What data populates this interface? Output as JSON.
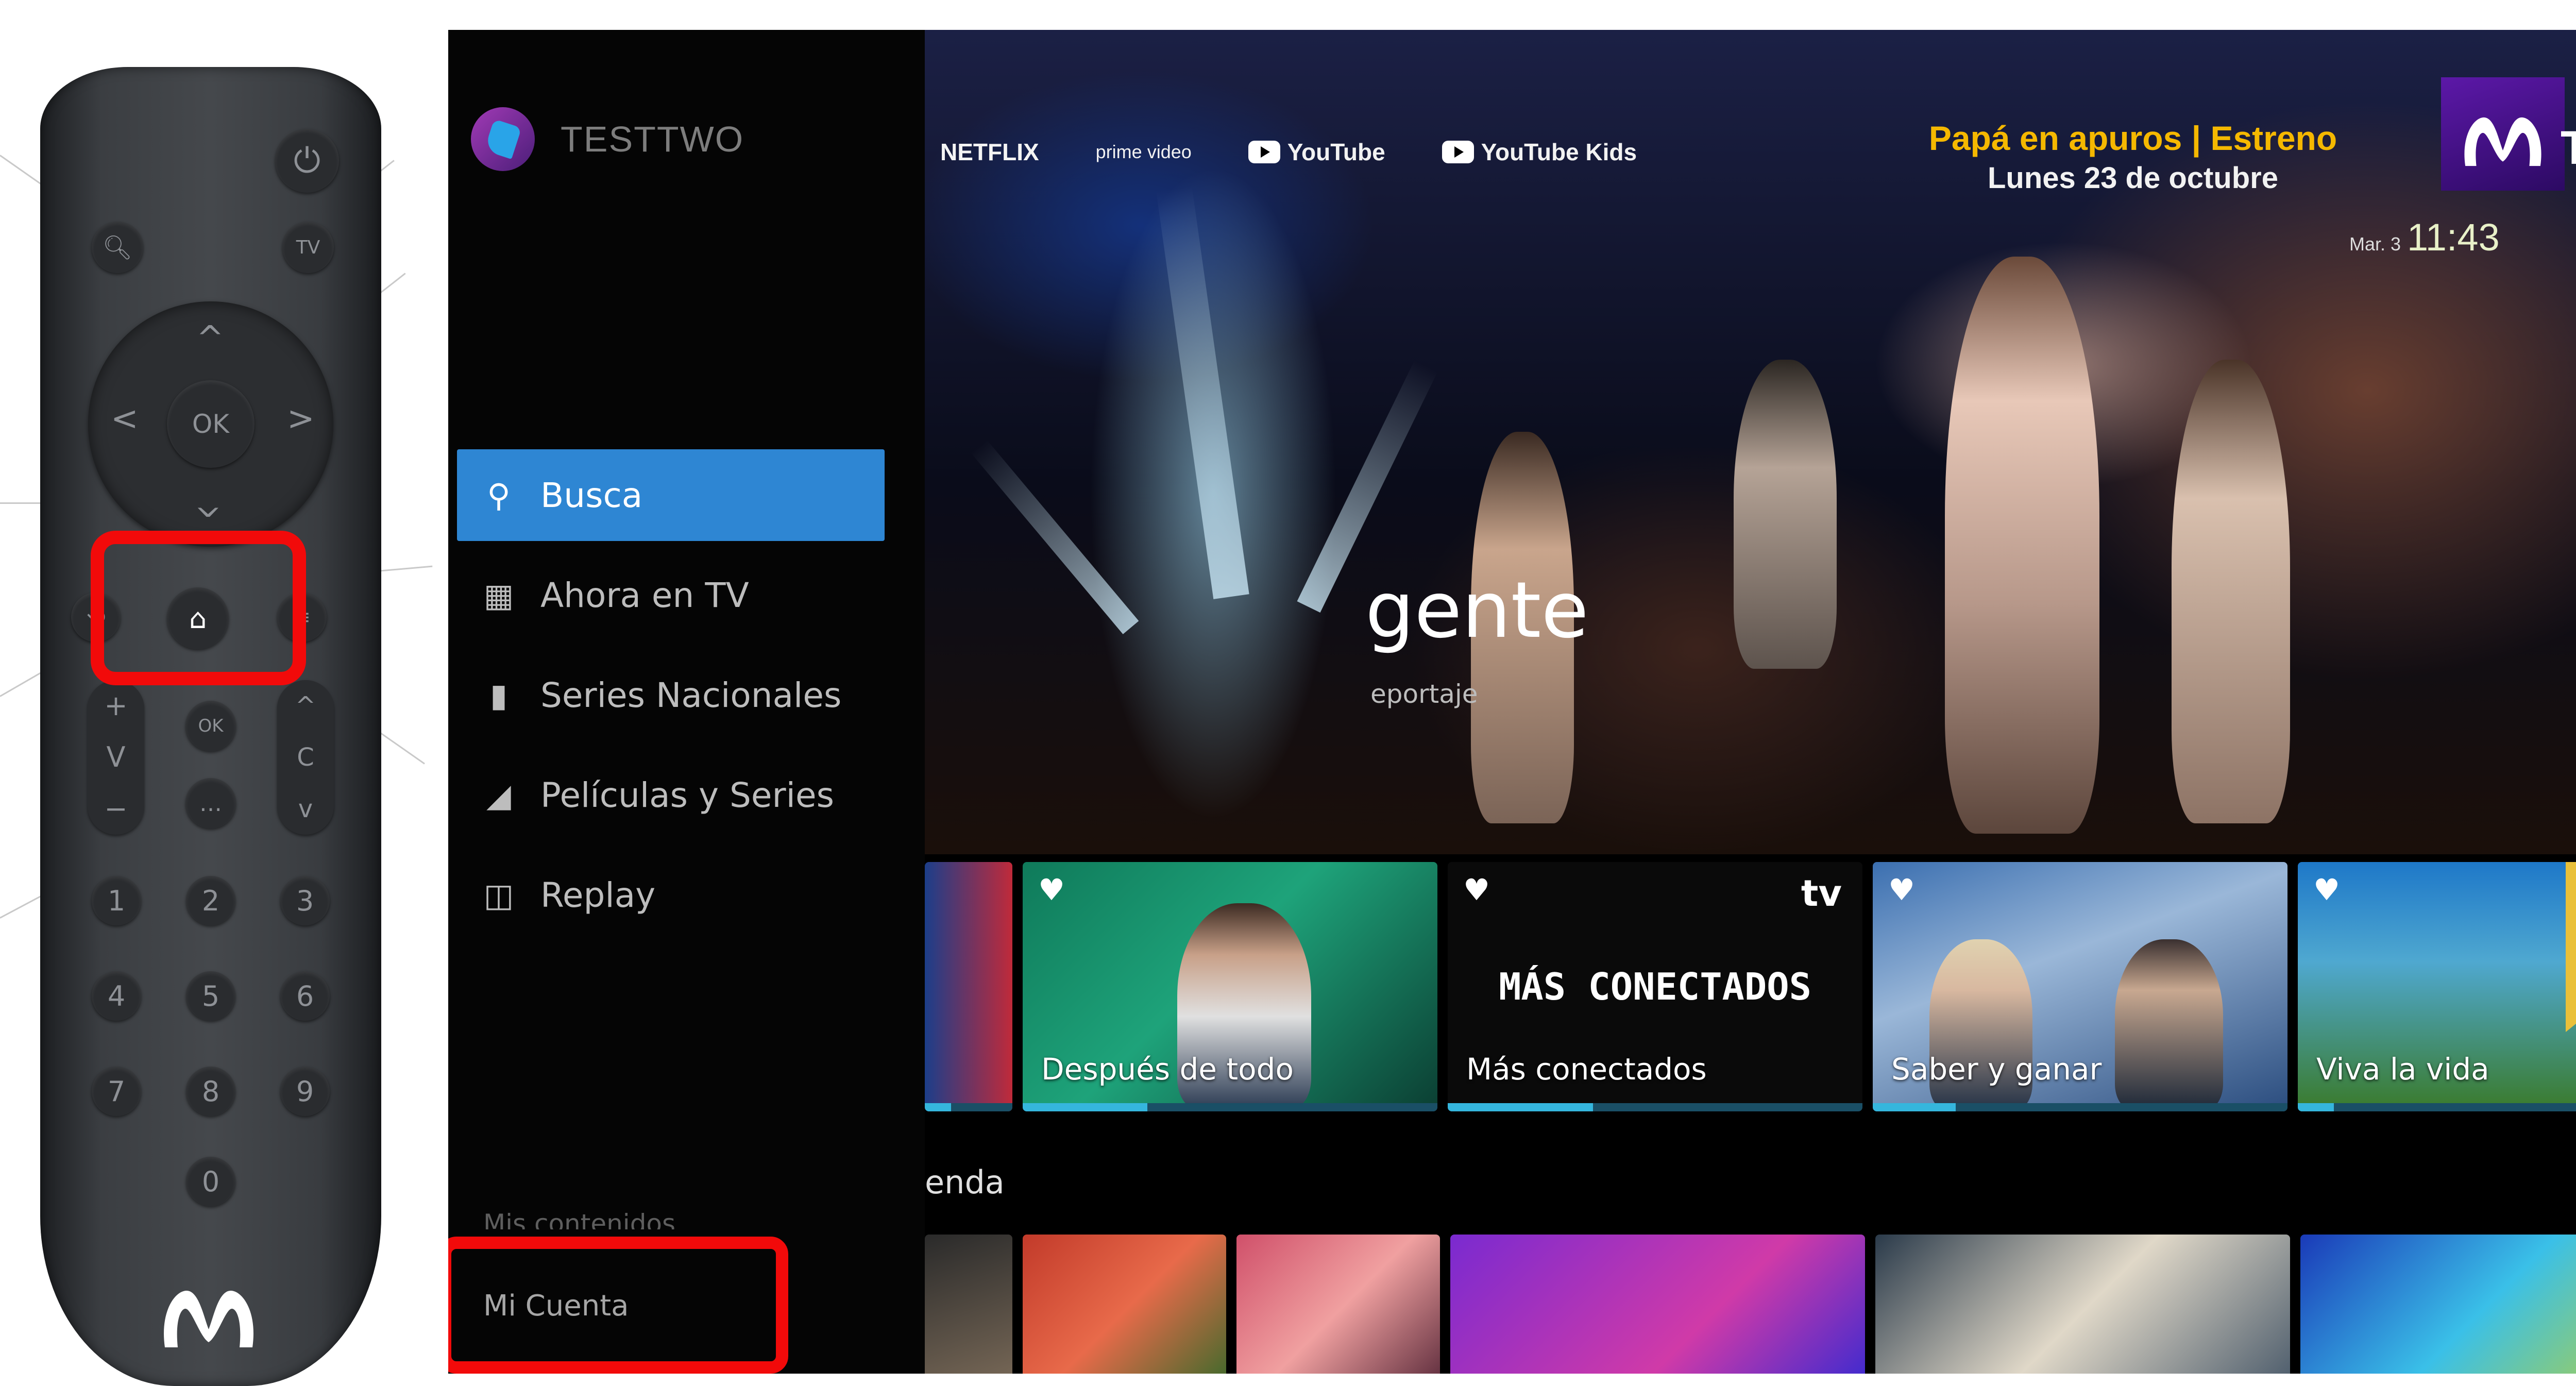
{
  "remote": {
    "nav_ok_label": "OK",
    "mid_ok_label": "OK",
    "number_keys": [
      "1",
      "2",
      "3",
      "4",
      "5",
      "6",
      "7",
      "8",
      "9",
      "0"
    ],
    "logo": "movistar-m-logo"
  },
  "tv": {
    "sidebar": {
      "profile_name": "TESTTWO",
      "menu_items": [
        {
          "label": "Busca",
          "icon": "search-icon"
        },
        {
          "label": "Ahora en TV",
          "icon": "live-tv-icon"
        },
        {
          "label": "Series Nacionales",
          "icon": "series-icon"
        },
        {
          "label": "Películas y Series",
          "icon": "movie-icon"
        },
        {
          "label": "Replay",
          "icon": "replay-icon"
        }
      ],
      "bottom_items": [
        "Mis contenidos",
        "Mi Cuenta"
      ]
    },
    "brands": [
      "NETFLIX",
      "prime video",
      "YouTube",
      "YouTube Kids"
    ],
    "promo": {
      "line1": "Papá en apuros | Estreno",
      "line2": "Lunes 23 de octubre"
    },
    "channel_logo_text": "Tv",
    "clock": {
      "day": "Mar. 3",
      "time": "11:43"
    },
    "hero": {
      "title": "gente",
      "subtitle": "eportaje"
    },
    "row1": [
      {
        "label": "",
        "progress": 0.3
      },
      {
        "label": "Después de todo",
        "progress": 0.3
      },
      {
        "label": "Más conectados",
        "progress": 0.35,
        "overlay": "MÁS CONECTADOS",
        "channel": "tv"
      },
      {
        "label": "Saber y ganar",
        "progress": 0.2
      },
      {
        "label": "Viva la vida",
        "progress": 0.1
      }
    ],
    "row2_title": "enda"
  },
  "colors": {
    "highlight": "#f20a0a",
    "accent": "#2e86d3",
    "progress": "#35b6dd"
  }
}
